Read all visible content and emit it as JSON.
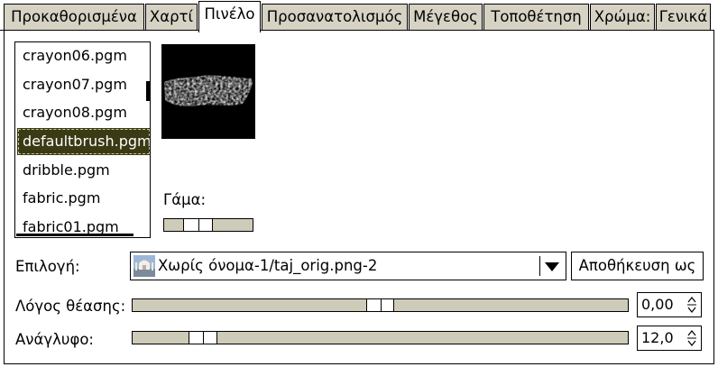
{
  "tabs": [
    {
      "label": "Προκαθορισμένα"
    },
    {
      "label": "Χαρτί"
    },
    {
      "label": "Πινέλο"
    },
    {
      "label": "Προσανατολισμός"
    },
    {
      "label": "Μέγεθος"
    },
    {
      "label": "Τοποθέτηση"
    },
    {
      "label": "Χρώμα:"
    },
    {
      "label": "Γενικά"
    }
  ],
  "active_tab": "Πινέλο",
  "brushes": [
    {
      "name": "crayon06.pgm"
    },
    {
      "name": "crayon07.pgm"
    },
    {
      "name": "crayon08.pgm"
    },
    {
      "name": "defaultbrush.pgm"
    },
    {
      "name": "dribble.pgm"
    },
    {
      "name": "fabric.pgm"
    },
    {
      "name": "fabric01.pgm"
    }
  ],
  "selected_brush": "defaultbrush.pgm",
  "gamma": {
    "label": "Γάμα:"
  },
  "selection": {
    "label": "Επιλογή:",
    "value": "Χωρίς όνομα-1/taj_orig.png-2",
    "save_label": "Αποθήκευση ως"
  },
  "aspect_ratio": {
    "label": "Λόγος θέασης:",
    "value": "0,00"
  },
  "relief": {
    "label": "Ανάγλυφο:",
    "value": "12,0"
  },
  "icons": [
    "image-thumbnail-icon",
    "dropdown-arrow-icon",
    "spin-arrows-icon"
  ]
}
